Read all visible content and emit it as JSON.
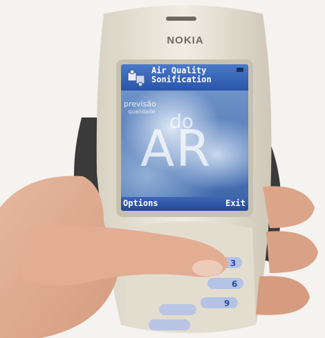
{
  "phone": {
    "brand": "NOKIA"
  },
  "screen": {
    "app_title": "Air Quality\nSonification",
    "splash": {
      "line1": "previsão",
      "line2": "qualidade",
      "line3": "do",
      "line4": "AR"
    },
    "softkeys": {
      "left": "Options",
      "right": "Exit"
    }
  },
  "keypad": {
    "digits": [
      "3",
      "6",
      "9"
    ]
  },
  "icons": {
    "app_icon": "puzzle-icon",
    "status_icon": "battery-icon"
  },
  "colors": {
    "screen_header": "#3a66b8",
    "softkey_bar": "#2b50a3",
    "keypad_light": "#3a5fd0"
  }
}
